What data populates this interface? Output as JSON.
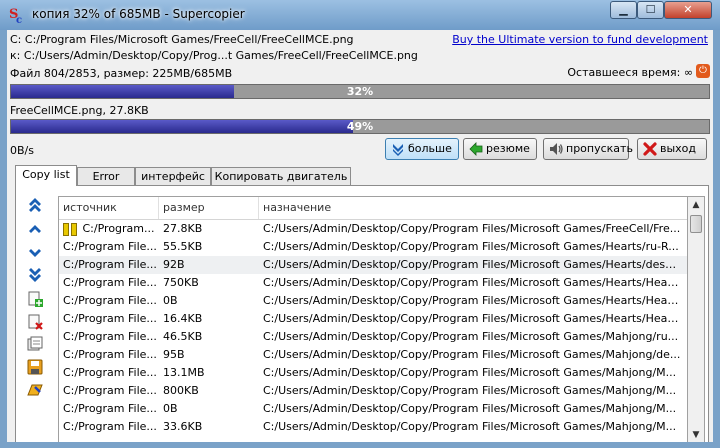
{
  "window": {
    "title": "копия 32% of 685MB - Supercopier",
    "min_label": "▁",
    "max_label": "☐",
    "close_label": "✕"
  },
  "transfer": {
    "source_line": "C: C:/Program Files/Microsoft Games/FreeCell/FreeCellMCE.png",
    "dest_line": "к:  C:/Users/Admin/Desktop/Copy/Prog...t Games/FreeCell/FreeCellMCE.png",
    "promo_link": "Buy the Ultimate version to fund development",
    "file_progress": "Файл 804/2853, размер: 225MB/685MB",
    "time_remaining_label": "Оставшееся время: ∞",
    "overall_percent": 32,
    "overall_label": "32%",
    "current_file": "FreeCellMCE.png, 27.8KB",
    "file_percent": 49,
    "file_label": "49%",
    "speed": "0B/s"
  },
  "buttons": {
    "more": "больше",
    "resume": "резюме",
    "skip": "пропускать",
    "exit": "выход"
  },
  "tabs": [
    "Copy list",
    "Error",
    "интерфейс",
    "Копировать двигатель"
  ],
  "list": {
    "columns": [
      "источник",
      "размер",
      "назначение"
    ],
    "rows": [
      {
        "source": "C:/Program...",
        "size": "27.8KB",
        "dest": "C:/Users/Admin/Desktop/Copy/Program Files/Microsoft Games/FreeCell/Fre..."
      },
      {
        "source": "C:/Program File...",
        "size": "55.5KB",
        "dest": "C:/Users/Admin/Desktop/Copy/Program Files/Microsoft Games/Hearts/ru-R..."
      },
      {
        "source": "C:/Program File...",
        "size": "92B",
        "dest": "C:/Users/Admin/Desktop/Copy/Program Files/Microsoft Games/Hearts/deskt..."
      },
      {
        "source": "C:/Program File...",
        "size": "750KB",
        "dest": "C:/Users/Admin/Desktop/Copy/Program Files/Microsoft Games/Hearts/Heart..."
      },
      {
        "source": "C:/Program File...",
        "size": "0B",
        "dest": "C:/Users/Admin/Desktop/Copy/Program Files/Microsoft Games/Hearts/Heart..."
      },
      {
        "source": "C:/Program File...",
        "size": "16.4KB",
        "dest": "C:/Users/Admin/Desktop/Copy/Program Files/Microsoft Games/Hearts/Heart..."
      },
      {
        "source": "C:/Program File...",
        "size": "46.5KB",
        "dest": "C:/Users/Admin/Desktop/Copy/Program Files/Microsoft Games/Mahjong/ru..."
      },
      {
        "source": "C:/Program File...",
        "size": "95B",
        "dest": "C:/Users/Admin/Desktop/Copy/Program Files/Microsoft Games/Mahjong/de..."
      },
      {
        "source": "C:/Program File...",
        "size": "13.1MB",
        "dest": "C:/Users/Admin/Desktop/Copy/Program Files/Microsoft Games/Mahjong/M..."
      },
      {
        "source": "C:/Program File...",
        "size": "800KB",
        "dest": "C:/Users/Admin/Desktop/Copy/Program Files/Microsoft Games/Mahjong/M..."
      },
      {
        "source": "C:/Program File...",
        "size": "0B",
        "dest": "C:/Users/Admin/Desktop/Copy/Program Files/Microsoft Games/Mahjong/M..."
      },
      {
        "source": "C:/Program File...",
        "size": "33.6KB",
        "dest": "C:/Users/Admin/Desktop/Copy/Program Files/Microsoft Games/Mahjong/M..."
      }
    ]
  },
  "icons": {
    "app": "supercopier-logo-icon",
    "side": [
      "move-to-top-icon",
      "move-up-icon",
      "move-down-icon",
      "move-to-bottom-icon",
      "add-file-icon",
      "remove-file-icon",
      "edit-item-icon",
      "save-list-icon",
      "load-list-icon"
    ]
  }
}
